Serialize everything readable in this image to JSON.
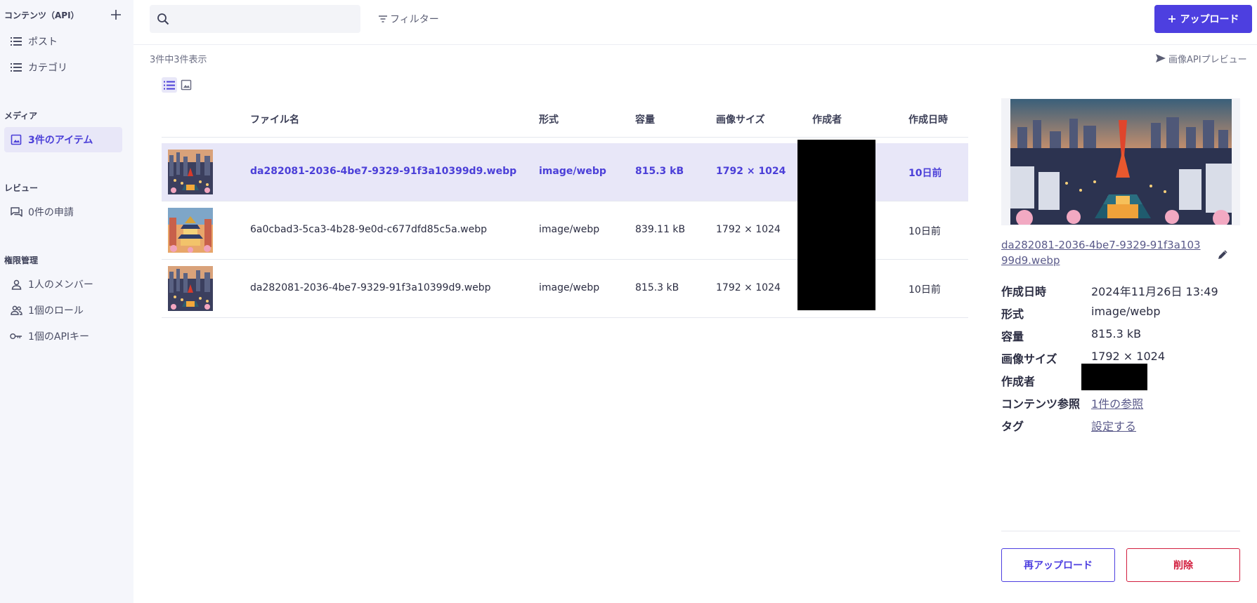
{
  "colors": {
    "accent": "#4d3fe0",
    "danger": "#d21e3e",
    "sidebar_bg": "#f5f6fb",
    "selected_bg": "#e8e7f8"
  },
  "sidebar": {
    "content_header": "コンテンツ（API）",
    "content_items": [
      {
        "label": "ポスト",
        "icon": "list-icon"
      },
      {
        "label": "カテゴリ",
        "icon": "list-icon"
      }
    ],
    "media_header": "メディア",
    "media_item": {
      "label": "3件のアイテム",
      "icon": "image-icon"
    },
    "review_header": "レビュー",
    "review_item": {
      "label": "0件の申請",
      "icon": "chat-icon"
    },
    "permission_header": "権限管理",
    "permission_items": [
      {
        "label": "1人のメンバー",
        "icon": "person-icon"
      },
      {
        "label": "1個のロール",
        "icon": "people-icon"
      },
      {
        "label": "1個のAPIキー",
        "icon": "key-icon"
      }
    ]
  },
  "toolbar": {
    "search_placeholder": "",
    "filter_label": "フィルター",
    "upload_label": "アップロード"
  },
  "list": {
    "count_text": "3件中3件表示",
    "preview_label": "画像APIプレビュー",
    "columns": [
      "ファイル名",
      "形式",
      "容量",
      "画像サイズ",
      "作成者",
      "作成日時"
    ],
    "rows": [
      {
        "name": "da282081-2036-4be7-9329-91f3a10399d9.webp",
        "type": "image/webp",
        "size": "815.3 kB",
        "dimensions": "1792 × 1024",
        "author": "",
        "date": "10日前",
        "selected": true
      },
      {
        "name": "6a0cbad3-5ca3-4b28-9e0d-c677dfd85c5a.webp",
        "type": "image/webp",
        "size": "839.11 kB",
        "dimensions": "1792 × 1024",
        "author": "",
        "date": "10日前",
        "selected": false
      },
      {
        "name": "da282081-2036-4be7-9329-91f3a10399d9.webp",
        "type": "image/webp",
        "size": "815.3 kB",
        "dimensions": "1792 × 1024",
        "author": "",
        "date": "10日前",
        "selected": false
      }
    ]
  },
  "detail": {
    "filename": "da282081-2036-4be7-9329-91f3a10399d9.webp",
    "meta": [
      {
        "key": "作成日時",
        "value": "2024年11月26日 13:49"
      },
      {
        "key": "形式",
        "value": "image/webp"
      },
      {
        "key": "容量",
        "value": "815.3 kB"
      },
      {
        "key": "画像サイズ",
        "value": "1792 × 1024"
      },
      {
        "key": "作成者",
        "value": ""
      },
      {
        "key": "コンテンツ参照",
        "value": "1件の参照"
      },
      {
        "key": "タグ",
        "value": "設定する"
      }
    ],
    "reupload_label": "再アップロード",
    "delete_label": "削除"
  }
}
